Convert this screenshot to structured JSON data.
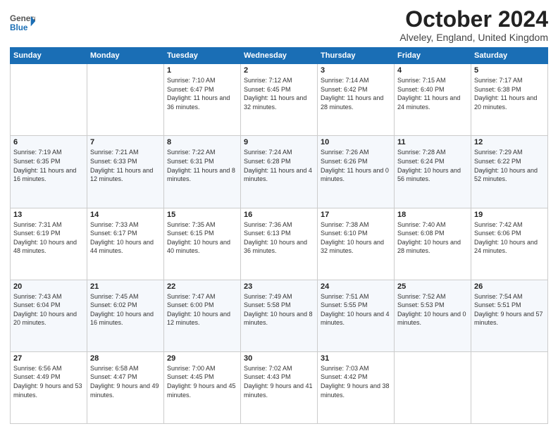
{
  "logo": {
    "general": "General",
    "blue": "Blue"
  },
  "header": {
    "title": "October 2024",
    "subtitle": "Alveley, England, United Kingdom"
  },
  "days": [
    "Sunday",
    "Monday",
    "Tuesday",
    "Wednesday",
    "Thursday",
    "Friday",
    "Saturday"
  ],
  "weeks": [
    [
      {
        "day": "",
        "sunrise": "",
        "sunset": "",
        "daylight": ""
      },
      {
        "day": "",
        "sunrise": "",
        "sunset": "",
        "daylight": ""
      },
      {
        "day": "1",
        "sunrise": "Sunrise: 7:10 AM",
        "sunset": "Sunset: 6:47 PM",
        "daylight": "Daylight: 11 hours and 36 minutes."
      },
      {
        "day": "2",
        "sunrise": "Sunrise: 7:12 AM",
        "sunset": "Sunset: 6:45 PM",
        "daylight": "Daylight: 11 hours and 32 minutes."
      },
      {
        "day": "3",
        "sunrise": "Sunrise: 7:14 AM",
        "sunset": "Sunset: 6:42 PM",
        "daylight": "Daylight: 11 hours and 28 minutes."
      },
      {
        "day": "4",
        "sunrise": "Sunrise: 7:15 AM",
        "sunset": "Sunset: 6:40 PM",
        "daylight": "Daylight: 11 hours and 24 minutes."
      },
      {
        "day": "5",
        "sunrise": "Sunrise: 7:17 AM",
        "sunset": "Sunset: 6:38 PM",
        "daylight": "Daylight: 11 hours and 20 minutes."
      }
    ],
    [
      {
        "day": "6",
        "sunrise": "Sunrise: 7:19 AM",
        "sunset": "Sunset: 6:35 PM",
        "daylight": "Daylight: 11 hours and 16 minutes."
      },
      {
        "day": "7",
        "sunrise": "Sunrise: 7:21 AM",
        "sunset": "Sunset: 6:33 PM",
        "daylight": "Daylight: 11 hours and 12 minutes."
      },
      {
        "day": "8",
        "sunrise": "Sunrise: 7:22 AM",
        "sunset": "Sunset: 6:31 PM",
        "daylight": "Daylight: 11 hours and 8 minutes."
      },
      {
        "day": "9",
        "sunrise": "Sunrise: 7:24 AM",
        "sunset": "Sunset: 6:28 PM",
        "daylight": "Daylight: 11 hours and 4 minutes."
      },
      {
        "day": "10",
        "sunrise": "Sunrise: 7:26 AM",
        "sunset": "Sunset: 6:26 PM",
        "daylight": "Daylight: 11 hours and 0 minutes."
      },
      {
        "day": "11",
        "sunrise": "Sunrise: 7:28 AM",
        "sunset": "Sunset: 6:24 PM",
        "daylight": "Daylight: 10 hours and 56 minutes."
      },
      {
        "day": "12",
        "sunrise": "Sunrise: 7:29 AM",
        "sunset": "Sunset: 6:22 PM",
        "daylight": "Daylight: 10 hours and 52 minutes."
      }
    ],
    [
      {
        "day": "13",
        "sunrise": "Sunrise: 7:31 AM",
        "sunset": "Sunset: 6:19 PM",
        "daylight": "Daylight: 10 hours and 48 minutes."
      },
      {
        "day": "14",
        "sunrise": "Sunrise: 7:33 AM",
        "sunset": "Sunset: 6:17 PM",
        "daylight": "Daylight: 10 hours and 44 minutes."
      },
      {
        "day": "15",
        "sunrise": "Sunrise: 7:35 AM",
        "sunset": "Sunset: 6:15 PM",
        "daylight": "Daylight: 10 hours and 40 minutes."
      },
      {
        "day": "16",
        "sunrise": "Sunrise: 7:36 AM",
        "sunset": "Sunset: 6:13 PM",
        "daylight": "Daylight: 10 hours and 36 minutes."
      },
      {
        "day": "17",
        "sunrise": "Sunrise: 7:38 AM",
        "sunset": "Sunset: 6:10 PM",
        "daylight": "Daylight: 10 hours and 32 minutes."
      },
      {
        "day": "18",
        "sunrise": "Sunrise: 7:40 AM",
        "sunset": "Sunset: 6:08 PM",
        "daylight": "Daylight: 10 hours and 28 minutes."
      },
      {
        "day": "19",
        "sunrise": "Sunrise: 7:42 AM",
        "sunset": "Sunset: 6:06 PM",
        "daylight": "Daylight: 10 hours and 24 minutes."
      }
    ],
    [
      {
        "day": "20",
        "sunrise": "Sunrise: 7:43 AM",
        "sunset": "Sunset: 6:04 PM",
        "daylight": "Daylight: 10 hours and 20 minutes."
      },
      {
        "day": "21",
        "sunrise": "Sunrise: 7:45 AM",
        "sunset": "Sunset: 6:02 PM",
        "daylight": "Daylight: 10 hours and 16 minutes."
      },
      {
        "day": "22",
        "sunrise": "Sunrise: 7:47 AM",
        "sunset": "Sunset: 6:00 PM",
        "daylight": "Daylight: 10 hours and 12 minutes."
      },
      {
        "day": "23",
        "sunrise": "Sunrise: 7:49 AM",
        "sunset": "Sunset: 5:58 PM",
        "daylight": "Daylight: 10 hours and 8 minutes."
      },
      {
        "day": "24",
        "sunrise": "Sunrise: 7:51 AM",
        "sunset": "Sunset: 5:55 PM",
        "daylight": "Daylight: 10 hours and 4 minutes."
      },
      {
        "day": "25",
        "sunrise": "Sunrise: 7:52 AM",
        "sunset": "Sunset: 5:53 PM",
        "daylight": "Daylight: 10 hours and 0 minutes."
      },
      {
        "day": "26",
        "sunrise": "Sunrise: 7:54 AM",
        "sunset": "Sunset: 5:51 PM",
        "daylight": "Daylight: 9 hours and 57 minutes."
      }
    ],
    [
      {
        "day": "27",
        "sunrise": "Sunrise: 6:56 AM",
        "sunset": "Sunset: 4:49 PM",
        "daylight": "Daylight: 9 hours and 53 minutes."
      },
      {
        "day": "28",
        "sunrise": "Sunrise: 6:58 AM",
        "sunset": "Sunset: 4:47 PM",
        "daylight": "Daylight: 9 hours and 49 minutes."
      },
      {
        "day": "29",
        "sunrise": "Sunrise: 7:00 AM",
        "sunset": "Sunset: 4:45 PM",
        "daylight": "Daylight: 9 hours and 45 minutes."
      },
      {
        "day": "30",
        "sunrise": "Sunrise: 7:02 AM",
        "sunset": "Sunset: 4:43 PM",
        "daylight": "Daylight: 9 hours and 41 minutes."
      },
      {
        "day": "31",
        "sunrise": "Sunrise: 7:03 AM",
        "sunset": "Sunset: 4:42 PM",
        "daylight": "Daylight: 9 hours and 38 minutes."
      },
      {
        "day": "",
        "sunrise": "",
        "sunset": "",
        "daylight": ""
      },
      {
        "day": "",
        "sunrise": "",
        "sunset": "",
        "daylight": ""
      }
    ]
  ]
}
